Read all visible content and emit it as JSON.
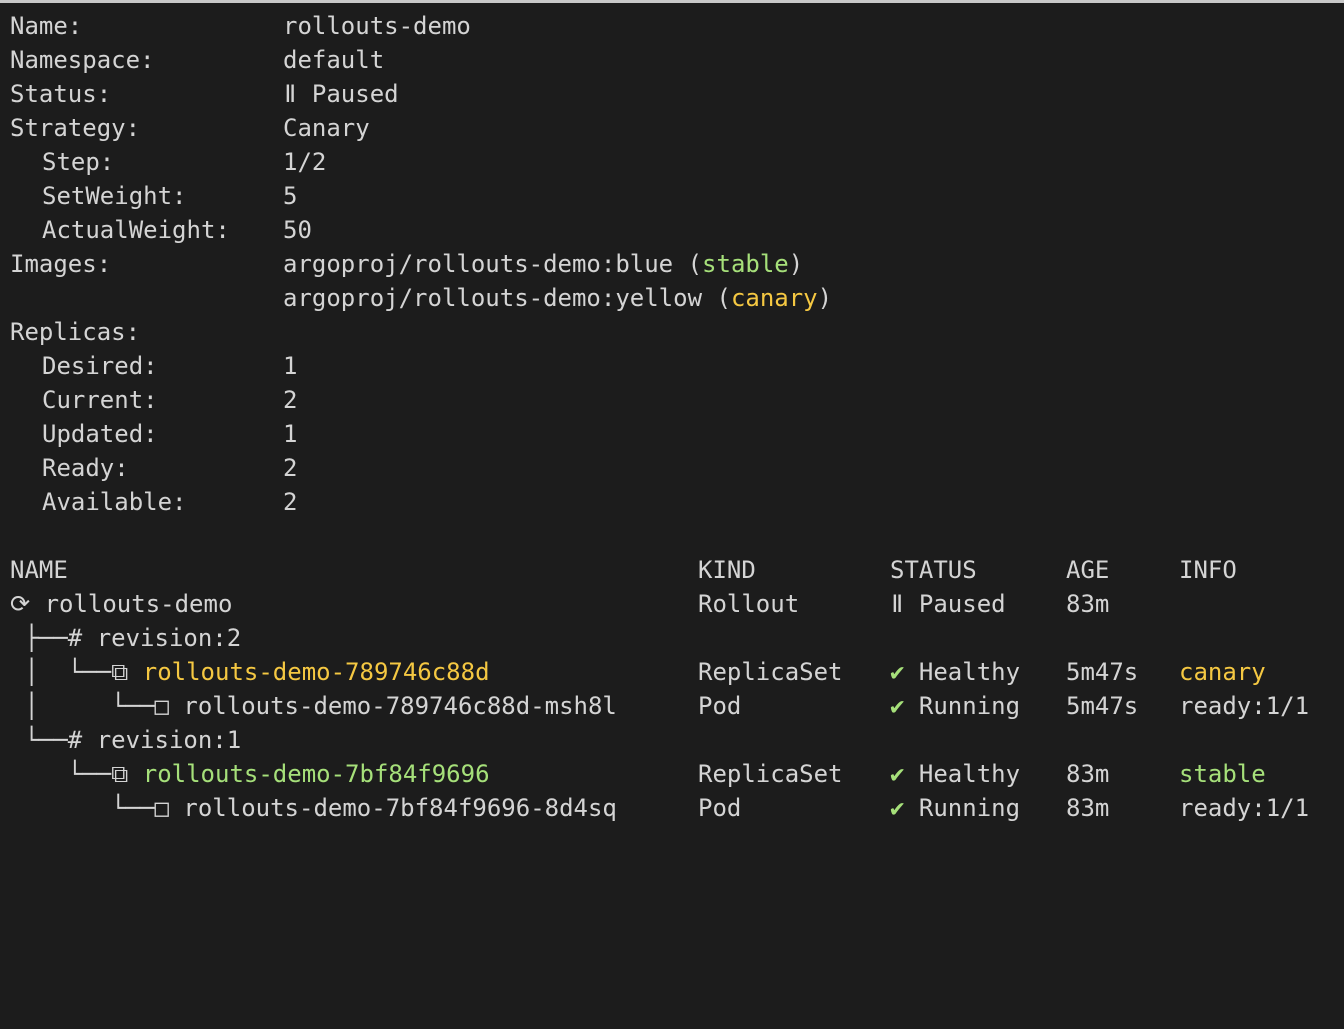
{
  "colors": {
    "background": "#1c1c1c",
    "text": "#d4d4d4",
    "green": "#a6e07a",
    "yellow": "#f5c842"
  },
  "summary": {
    "name": {
      "key": "Name:",
      "value": "rollouts-demo"
    },
    "namespace": {
      "key": "Namespace:",
      "value": "default"
    },
    "status": {
      "key": "Status:",
      "icon": "ǁ",
      "value": "Paused"
    },
    "strategy": {
      "key": "Strategy:",
      "value": "Canary"
    },
    "step": {
      "key": "Step:",
      "value": "1/2"
    },
    "setweight": {
      "key": "SetWeight:",
      "value": "5"
    },
    "actualweight": {
      "key": "ActualWeight:",
      "value": "50"
    },
    "images": {
      "key": "Images:",
      "stable_image": "argoproj/rollouts-demo:blue",
      "stable_tag": "stable",
      "canary_image": "argoproj/rollouts-demo:yellow",
      "canary_tag": "canary"
    },
    "replicas": {
      "key": "Replicas:",
      "desired": {
        "key": "Desired:",
        "value": "1"
      },
      "current": {
        "key": "Current:",
        "value": "2"
      },
      "updated": {
        "key": "Updated:",
        "value": "1"
      },
      "ready": {
        "key": "Ready:",
        "value": "2"
      },
      "available": {
        "key": "Available:",
        "value": "2"
      }
    }
  },
  "table": {
    "headers": {
      "name": "NAME",
      "kind": "KIND",
      "status": "STATUS",
      "age": "AGE",
      "info": "INFO"
    },
    "rows": [
      {
        "prefix": "",
        "icon": "⟳",
        "name": "rollouts-demo",
        "kind": "Rollout",
        "status_icon": "ǁ",
        "status": "Paused",
        "age": "83m",
        "info": ""
      },
      {
        "prefix": " ├──",
        "icon": "#",
        "name": "revision:2",
        "kind": "",
        "status_icon": "",
        "status": "",
        "age": "",
        "info": ""
      },
      {
        "prefix": " │  └──",
        "icon": "⧉",
        "name": "rollouts-demo-789746c88d",
        "kind": "ReplicaSet",
        "status_icon": "✔",
        "status": "Healthy",
        "age": "5m47s",
        "info": "canary"
      },
      {
        "prefix": " │     └──",
        "icon": "□",
        "name": "rollouts-demo-789746c88d-msh8l",
        "kind": "Pod",
        "status_icon": "✔",
        "status": "Running",
        "age": "5m47s",
        "info": "ready:1/1"
      },
      {
        "prefix": " └──",
        "icon": "#",
        "name": "revision:1",
        "kind": "",
        "status_icon": "",
        "status": "",
        "age": "",
        "info": ""
      },
      {
        "prefix": "    └──",
        "icon": "⧉",
        "name": "rollouts-demo-7bf84f9696",
        "kind": "ReplicaSet",
        "status_icon": "✔",
        "status": "Healthy",
        "age": "83m",
        "info": "stable"
      },
      {
        "prefix": "       └──",
        "icon": "□",
        "name": "rollouts-demo-7bf84f9696-8d4sq",
        "kind": "Pod",
        "status_icon": "✔",
        "status": "Running",
        "age": "83m",
        "info": "ready:1/1"
      }
    ]
  }
}
